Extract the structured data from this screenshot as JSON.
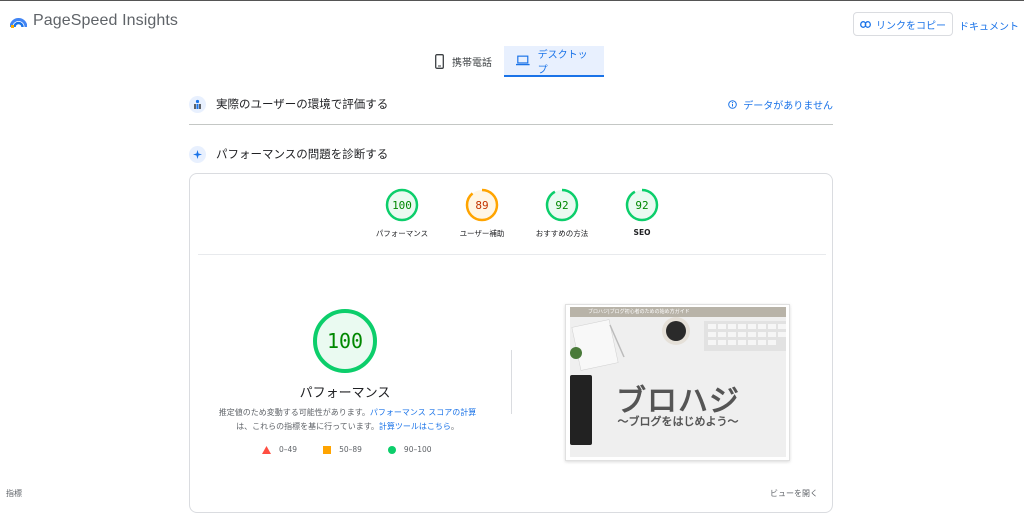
{
  "app": {
    "title": "PageSpeed Insights"
  },
  "header": {
    "copy_link_label": "リンクをコピー",
    "docs_label": "ドキュメント"
  },
  "tabs": [
    {
      "label": "携帯電話",
      "icon": "smartphone-icon",
      "active": false
    },
    {
      "label": "デスクトップ",
      "icon": "laptop-icon",
      "active": true
    }
  ],
  "field_section": {
    "title": "実際のユーザーの環境で評価する",
    "no_data_label": "データがありません"
  },
  "lab_section": {
    "title": "パフォーマンスの問題を診断する"
  },
  "scores": [
    {
      "label": "パフォーマンス",
      "value": "100",
      "score": 1.0,
      "color": "#0cce6b"
    },
    {
      "label": "ユーザー補助",
      "value": "89",
      "score": 0.89,
      "color": "#ffa400"
    },
    {
      "label": "おすすめの方法",
      "value": "92",
      "score": 0.92,
      "color": "#0cce6b"
    },
    {
      "label": "SEO",
      "value": "92",
      "score": 0.92,
      "color": "#0cce6b"
    }
  ],
  "main_score": {
    "value": "100",
    "label": "パフォーマンス",
    "score": 1.0
  },
  "description": {
    "part1": "推定値のため変動する可能性があります。",
    "link1": "パフォーマンス スコアの計算",
    "part2": "は、これらの指標を基に行っています。",
    "link2": "計算ツールはこちら",
    "part3": "。"
  },
  "legend": [
    {
      "range": "0–49",
      "color": "#ff4e42",
      "shape": "triangle"
    },
    {
      "range": "50–89",
      "color": "#ffa400",
      "shape": "square"
    },
    {
      "range": "90–100",
      "color": "#0cce6b",
      "shape": "circle"
    }
  ],
  "screenshot": {
    "header_text": "ブロハジ|ブログ初心者のための始め方ガイド",
    "title": "ブロハジ",
    "subtitle": "～ブログをはじめよう～"
  },
  "footer": {
    "metrics_label": "指標",
    "expand_label": "ビューを開く"
  }
}
